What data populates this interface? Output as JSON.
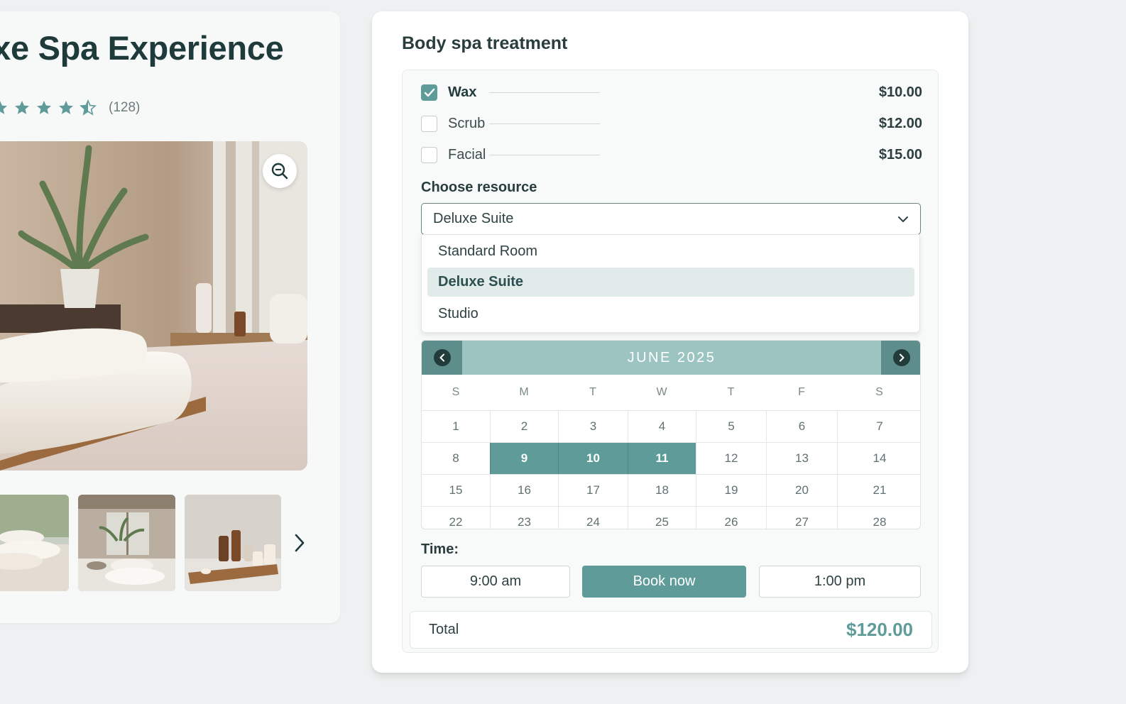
{
  "product": {
    "title": "luxe Spa Experience",
    "rating_count": "(128)",
    "rating_value": 4.5,
    "icons": {
      "zoom": "zoom-in-icon",
      "star": "star-icon",
      "next": "chevron-right-icon"
    }
  },
  "booking": {
    "title": "Body spa treatment",
    "addons": [
      {
        "label": "Wax",
        "price": "$10.00",
        "checked": true
      },
      {
        "label": "Scrub",
        "price": "$12.00",
        "checked": false
      },
      {
        "label": "Facial",
        "price": "$15.00",
        "checked": false
      }
    ],
    "resource": {
      "label": "Choose resource",
      "selected": "Deluxe Suite",
      "options": [
        "Standard Room",
        "Deluxe Suite",
        "Studio"
      ]
    },
    "calendar": {
      "month": "JUNE 2025",
      "weekdays": [
        "S",
        "M",
        "T",
        "W",
        "T",
        "F",
        "S"
      ],
      "weeks": [
        [
          "1",
          "2",
          "3",
          "4",
          "5",
          "6",
          "7"
        ],
        [
          "8",
          "9",
          "10",
          "11",
          "12",
          "13",
          "14"
        ],
        [
          "15",
          "16",
          "17",
          "18",
          "19",
          "20",
          "21"
        ],
        [
          "22",
          "23",
          "24",
          "25",
          "26",
          "27",
          "28"
        ]
      ],
      "selected_days": [
        "9",
        "10",
        "11"
      ]
    },
    "time": {
      "label": "Time:",
      "slots": [
        "9:00 am",
        "1:00 pm"
      ],
      "book_label": "Book now"
    },
    "total": {
      "label": "Total",
      "value": "$120.00"
    }
  },
  "colors": {
    "accent": "#5f9c99",
    "calendar_header": "#9cc4c1",
    "calendar_nav": "#5e8e8b",
    "text_dark": "#1f3a3a",
    "page_bg": "#eef1f1"
  }
}
